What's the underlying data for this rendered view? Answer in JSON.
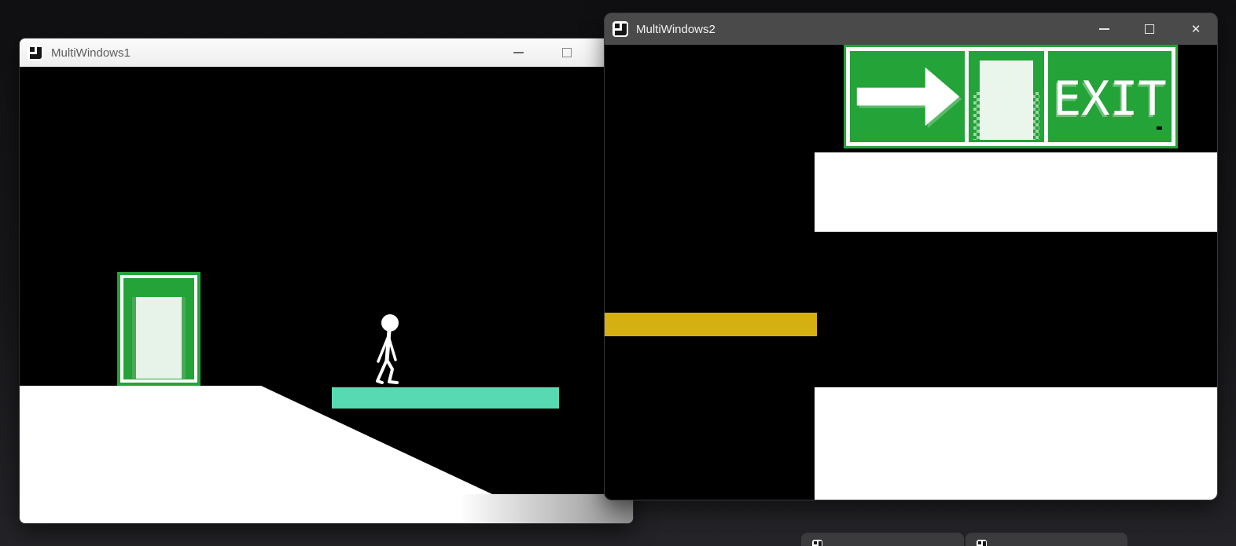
{
  "colors": {
    "desktop-top": "#101012",
    "desktop-bottom": "#242428",
    "green": "#23a338",
    "door-light": "#e7f2e8",
    "door-trim": "#4aa957",
    "teal": "#57dab2",
    "gold": "#d5b012",
    "w1-titlebar": "#f4f4f4",
    "w1-title-text": "#5d5d5d",
    "w2-titlebar": "#4a4a4b",
    "w2-title-text": "#f2f2f2",
    "scene-black": "#000000",
    "floor-white": "#ffffff",
    "mini-titlebar": "#3b3b3d"
  },
  "window1": {
    "title": "MultiWindows1",
    "app_icon": "monogame-logo",
    "controls": {
      "minimize": "–",
      "maximize": "□"
    },
    "scene": {
      "objects": [
        "exit-door",
        "stick-figure-character",
        "teal-platform",
        "white-floor-slope"
      ]
    }
  },
  "window2": {
    "title": "MultiWindows2",
    "app_icon": "monogame-logo",
    "controls": {
      "minimize": "–",
      "maximize": "□",
      "close": "✕"
    },
    "scene": {
      "sign": {
        "exit_label": "EXIT",
        "panels": [
          "right-arrow",
          "open-door",
          "exit-text"
        ]
      },
      "objects": [
        "exit-sign",
        "gold-platform",
        "white-ledge-upper",
        "white-ledge-lower"
      ]
    }
  },
  "mini_windows": {
    "count": 2,
    "app_icon": "monogame-logo"
  }
}
